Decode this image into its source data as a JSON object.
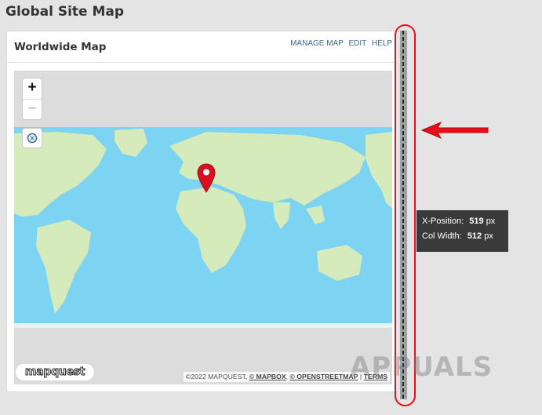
{
  "page": {
    "title": "Global Site Map"
  },
  "panel": {
    "title": "Worldwide Map",
    "actions": {
      "manage_map": "MANAGE MAP",
      "edit": "EDIT",
      "help": "HELP"
    }
  },
  "map": {
    "zoom_in": "+",
    "zoom_out": "−",
    "reset_icon": "recenter-icon",
    "marker_icon": "location-pin-icon",
    "logo": "mapquest",
    "attribution": {
      "copyright": "©2022 MAPQUEST,",
      "mapbox": "© MAPBOX",
      "osm": "© OPENSTREETMAP",
      "separator": "|",
      "terms": "TERMS"
    },
    "colors": {
      "water": "#7dd3f2",
      "land": "#d5ebbc",
      "empty": "#dcdcdc",
      "pin": "#d6101e"
    }
  },
  "column_divider": {
    "tooltip": {
      "x_label": "X-Position:",
      "x_value": "519",
      "x_unit": "px",
      "w_label": "Col Width:",
      "w_value": "512",
      "w_unit": "px"
    }
  },
  "annotations": {
    "highlight_color": "#e3101b",
    "arrow_icon": "red-arrow-left-icon"
  },
  "watermark": "APPUALS"
}
